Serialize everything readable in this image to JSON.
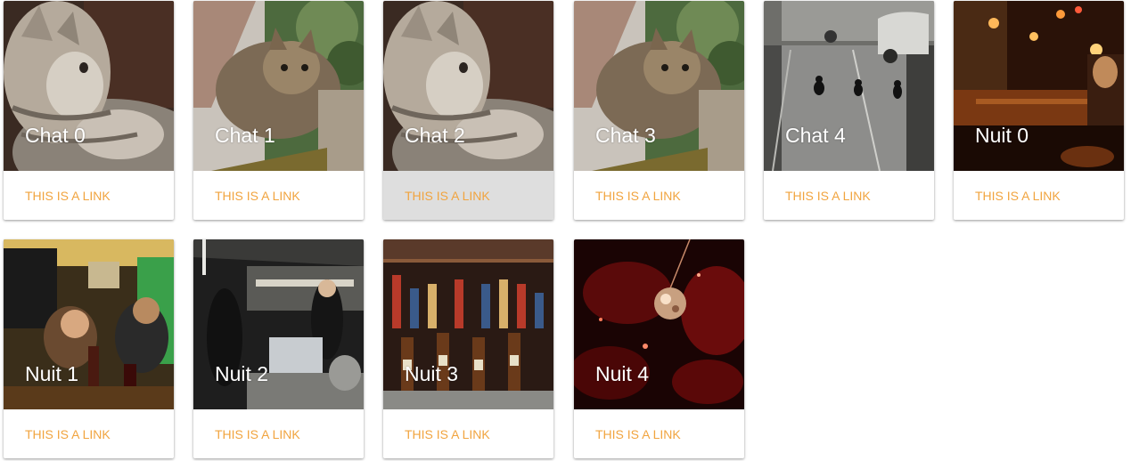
{
  "link_color": "#f1a43f",
  "hover_background": "#dedede",
  "cards": [
    {
      "title": "Chat 0",
      "link": "THIS IS A LINK",
      "image": "cat-profile-photo"
    },
    {
      "title": "Chat 1",
      "link": "THIS IS A LINK",
      "image": "cat-on-fence-photo"
    },
    {
      "title": "Chat 2",
      "link": "THIS IS A LINK",
      "image": "cat-profile-photo",
      "hovered": true
    },
    {
      "title": "Chat 3",
      "link": "THIS IS A LINK",
      "image": "cat-on-fence-photo"
    },
    {
      "title": "Chat 4",
      "link": "THIS IS A LINK",
      "image": "three-cats-parking-lot-photo"
    },
    {
      "title": "Nuit 0",
      "link": "THIS IS A LINK",
      "image": "night-bar-photo"
    },
    {
      "title": "Nuit 1",
      "link": "THIS IS A LINK",
      "image": "people-in-bar-photo"
    },
    {
      "title": "Nuit 2",
      "link": "THIS IS A LINK",
      "image": "bar-interior-photo"
    },
    {
      "title": "Nuit 3",
      "link": "THIS IS A LINK",
      "image": "liquor-bottles-photo"
    },
    {
      "title": "Nuit 4",
      "link": "THIS IS A LINK",
      "image": "disco-ball-club-photo"
    }
  ]
}
